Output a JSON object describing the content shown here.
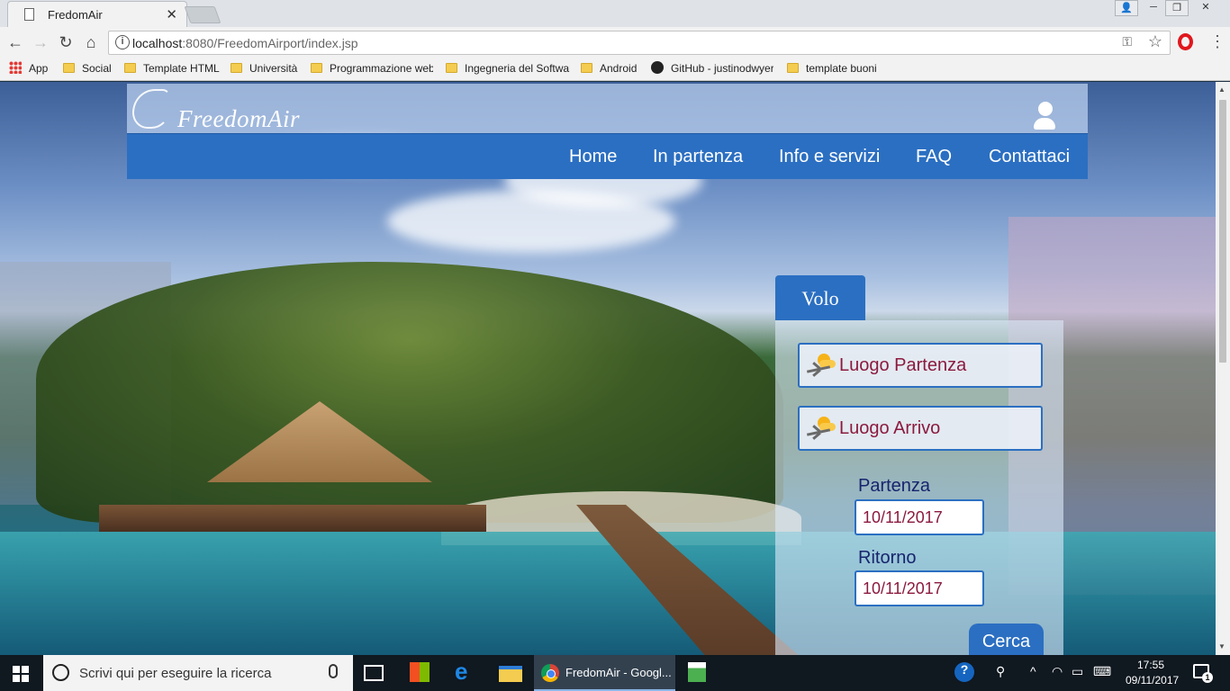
{
  "browser": {
    "tab_title": "FredomAir",
    "url_host": "localhost",
    "url_rest": ":8080/FreedomAirport/index.jsp",
    "bookmarks": [
      "App",
      "Social",
      "Template HTML",
      "Università",
      "Programmazione web",
      "Ingegneria del Software",
      "Android",
      "GitHub - justinodwyer",
      "template buoni"
    ]
  },
  "site": {
    "logo": "FreedomAir",
    "nav": [
      "Home",
      "In partenza",
      "Info e servizi",
      "FAQ",
      "Contattaci"
    ]
  },
  "search": {
    "tab": "Volo",
    "from_placeholder": "Luogo Partenza",
    "to_placeholder": "Luogo Arrivo",
    "departure_label": "Partenza",
    "departure_value": "10/11/2017",
    "return_label": "Ritorno",
    "return_value": "10/11/2017",
    "submit": "Cerca"
  },
  "taskbar": {
    "search_placeholder": "Scrivi qui per eseguire la ricerca",
    "chrome_task": "FredomAir - Googl...",
    "time": "17:55",
    "date": "09/11/2017",
    "notifications": "1"
  }
}
